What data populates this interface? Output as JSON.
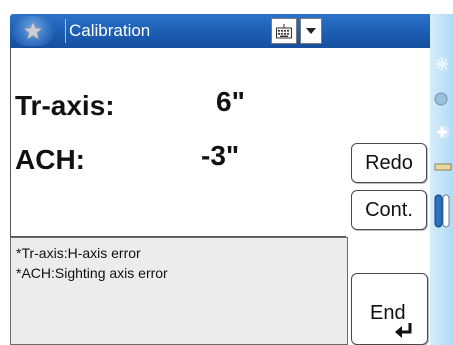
{
  "window": {
    "title": "Calibration",
    "start_icon": "star-icon",
    "keyboard_icon": "keyboard-icon",
    "dropdown_icon": "chevron-down-icon"
  },
  "readings": [
    {
      "label": "Tr-axis:",
      "value": "6\""
    },
    {
      "label": "ACH:",
      "value": "-3\""
    }
  ],
  "buttons": {
    "redo": "Redo",
    "cont": "Cont.",
    "end": "End"
  },
  "notes": [
    "*Tr-axis:H-axis error",
    "*ACH:Sighting axis error"
  ],
  "colors": {
    "titlebar": "#1c5eb4",
    "side_panel": "#aedbf6"
  }
}
